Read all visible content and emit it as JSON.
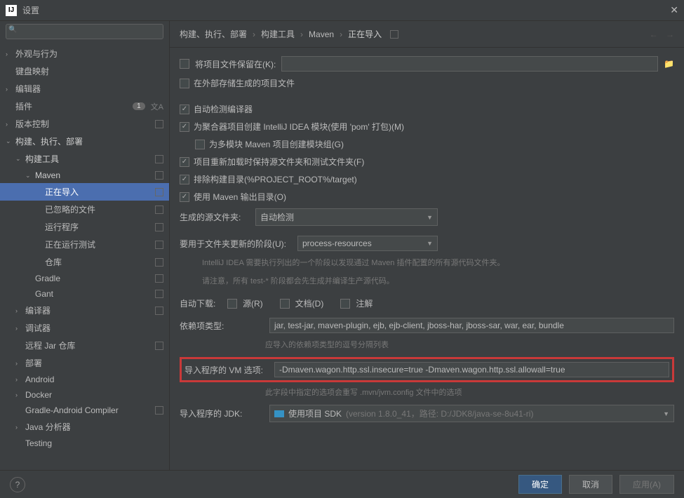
{
  "window": {
    "title": "设置"
  },
  "search": {
    "placeholder": ""
  },
  "sidebar": {
    "items": [
      {
        "label": "外观与行为",
        "chevron": "›",
        "scope": ""
      },
      {
        "label": "键盘映射",
        "chevron": "",
        "scope": ""
      },
      {
        "label": "编辑器",
        "chevron": "›",
        "scope": ""
      },
      {
        "label": "插件",
        "chevron": "",
        "badge": "1",
        "lang": true
      },
      {
        "label": "版本控制",
        "chevron": "›",
        "scope": "⊡"
      },
      {
        "label": "构建、执行、部署",
        "chevron": "⌄",
        "bold": true
      },
      {
        "label": "构建工具",
        "chevron": "⌄",
        "indent": 1,
        "scope": "⊡",
        "bold": true
      },
      {
        "label": "Maven",
        "chevron": "⌄",
        "indent": 2,
        "scope": "⊡",
        "bold": true
      },
      {
        "label": "正在导入",
        "indent": 3,
        "scope": "⊡",
        "selected": true
      },
      {
        "label": "已忽略的文件",
        "indent": 3,
        "scope": "⊡"
      },
      {
        "label": "运行程序",
        "indent": 3,
        "scope": "⊡"
      },
      {
        "label": "正在运行测试",
        "indent": 3,
        "scope": "⊡"
      },
      {
        "label": "仓库",
        "indent": 3,
        "scope": "⊡"
      },
      {
        "label": "Gradle",
        "indent": 2,
        "scope": "⊡"
      },
      {
        "label": "Gant",
        "indent": 2,
        "scope": "⊡"
      },
      {
        "label": "编译器",
        "chevron": "›",
        "indent": 1,
        "scope": "⊡"
      },
      {
        "label": "调试器",
        "chevron": "›",
        "indent": 1
      },
      {
        "label": "远程 Jar 仓库",
        "indent": 1,
        "scope": "⊡"
      },
      {
        "label": "部署",
        "chevron": "›",
        "indent": 1
      },
      {
        "label": "Android",
        "chevron": "›",
        "indent": 1
      },
      {
        "label": "Docker",
        "chevron": "›",
        "indent": 1
      },
      {
        "label": "Gradle-Android Compiler",
        "indent": 1,
        "scope": "⊡"
      },
      {
        "label": "Java 分析器",
        "chevron": "›",
        "indent": 1
      },
      {
        "label": "Testing",
        "indent": 1
      }
    ]
  },
  "breadcrumb": {
    "items": [
      "构建、执行、部署",
      "构建工具",
      "Maven",
      "正在导入"
    ]
  },
  "form": {
    "keep_project_files": {
      "label": "将项目文件保留在(K):",
      "value": ""
    },
    "store_external": "在外部存储生成的项目文件",
    "auto_detect_compiler": "自动检测编译器",
    "aggregator": "为聚合器项目创建 IntelliJ IDEA 模块(使用 'pom' 打包)(M)",
    "multimodule": "为多模块 Maven 项目创建模块组(G)",
    "keep_sources": "项目重新加载时保持源文件夹和测试文件夹(F)",
    "exclude_build": "排除构建目录(%PROJECT_ROOT%/target)",
    "use_output": "使用 Maven 输出目录(O)",
    "generated_sources": {
      "label": "生成的源文件夹:",
      "value": "自动检测"
    },
    "phase": {
      "label": "要用于文件夹更新的阶段(U):",
      "value": "process-resources"
    },
    "phase_hint1": "IntelliJ IDEA 需要执行列出的一个阶段以发现通过 Maven 插件配置的所有源代码文件夹。",
    "phase_hint2": "请注意，所有 test-* 阶段都会先生成并编译生产源代码。",
    "auto_download_label": "自动下载:",
    "auto_download": {
      "sources": "源(R)",
      "docs": "文档(D)",
      "annotations": "注解"
    },
    "dep_types": {
      "label": "依赖项类型:",
      "value": "jar, test-jar, maven-plugin, ejb, ejb-client, jboss-har, jboss-sar, war, ear, bundle",
      "hint": "应导入的依赖项类型的逗号分隔列表"
    },
    "vm_options": {
      "label": "导入程序的 VM 选项:",
      "value": "-Dmaven.wagon.http.ssl.insecure=true -Dmaven.wagon.http.ssl.allowall=true",
      "hint": "此字段中指定的选项会重写 .mvn/jvm.config 文件中的选项"
    },
    "jdk": {
      "label": "导入程序的 JDK:",
      "name": "使用项目 SDK",
      "detail": "(version 1.8.0_41，路径: D:/JDK8/java-se-8u41-ri)"
    }
  },
  "footer": {
    "ok": "确定",
    "cancel": "取消",
    "apply": "应用(A)"
  }
}
